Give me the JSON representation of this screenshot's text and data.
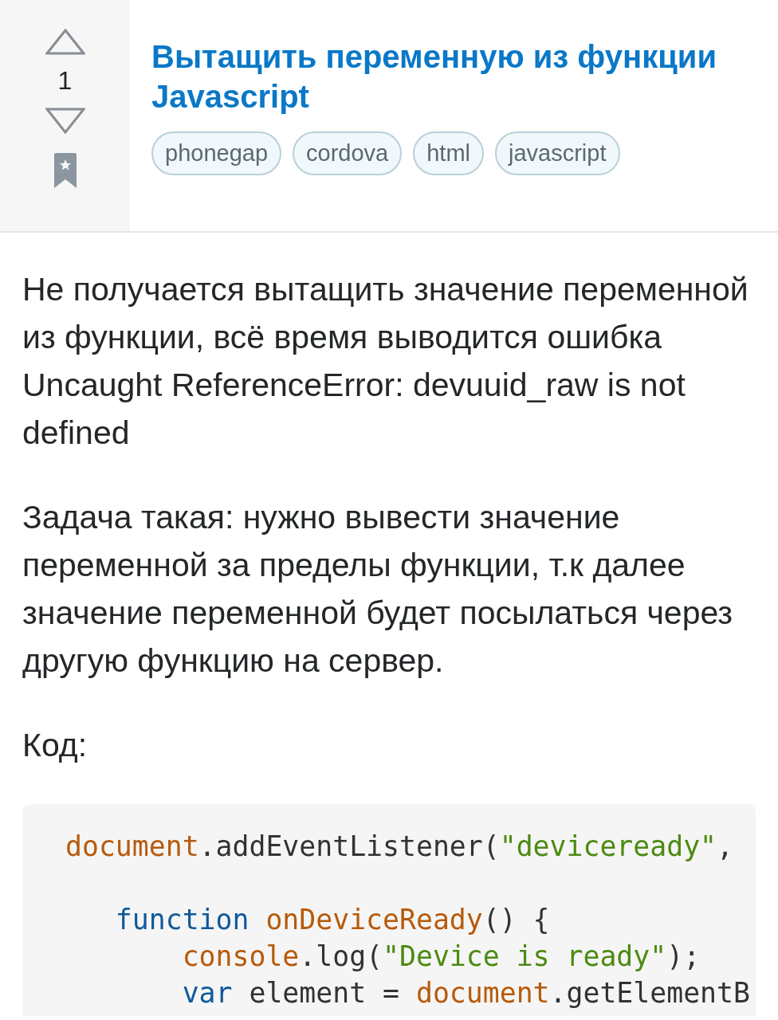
{
  "question": {
    "score": "1",
    "title": "Вытащить переменную из функции Javascript",
    "tags": [
      "phonegap",
      "cordova",
      "html",
      "javascript"
    ]
  },
  "body": {
    "paragraphs": [
      "Не получается вытащить значение переменной из функции, всё время выводится ошибка Uncaught ReferenceError: devuuid_raw is not defined",
      "Задача такая: нужно вывести значение переменной за пределы функции, т.к далее значение переменной будет посылаться через другую функцию на сервер.",
      "Код:"
    ],
    "code": {
      "lines": [
        {
          "kind": "code",
          "tokens": [
            {
              "kind": "name",
              "text": "document"
            },
            {
              "kind": "plain",
              "text": ".addEventListener("
            },
            {
              "kind": "string",
              "text": "\"deviceready\""
            },
            {
              "kind": "plain",
              "text": ","
            }
          ],
          "children": [
            {
              "kind": "blank"
            },
            {
              "kind": "code",
              "tokens": [
                {
                  "kind": "keyword",
                  "text": "function"
                },
                {
                  "kind": "name",
                  "text": " onDeviceReady"
                },
                {
                  "kind": "plain",
                  "text": "() {"
                }
              ],
              "children": [
                {
                  "kind": "code",
                  "tokens": [
                    {
                      "kind": "name",
                      "text": "console"
                    },
                    {
                      "kind": "plain",
                      "text": ".log("
                    },
                    {
                      "kind": "string",
                      "text": "\"Device is ready\""
                    },
                    {
                      "kind": "plain",
                      "text": ");"
                    }
                  ]
                },
                {
                  "kind": "code",
                  "tokens": [
                    {
                      "kind": "keyword",
                      "text": "var"
                    },
                    {
                      "kind": "plain",
                      "text": " element = "
                    },
                    {
                      "kind": "name",
                      "text": "document"
                    },
                    {
                      "kind": "plain",
                      "text": ".getElementB"
                    }
                  ]
                }
              ]
            }
          ]
        }
      ]
    }
  }
}
